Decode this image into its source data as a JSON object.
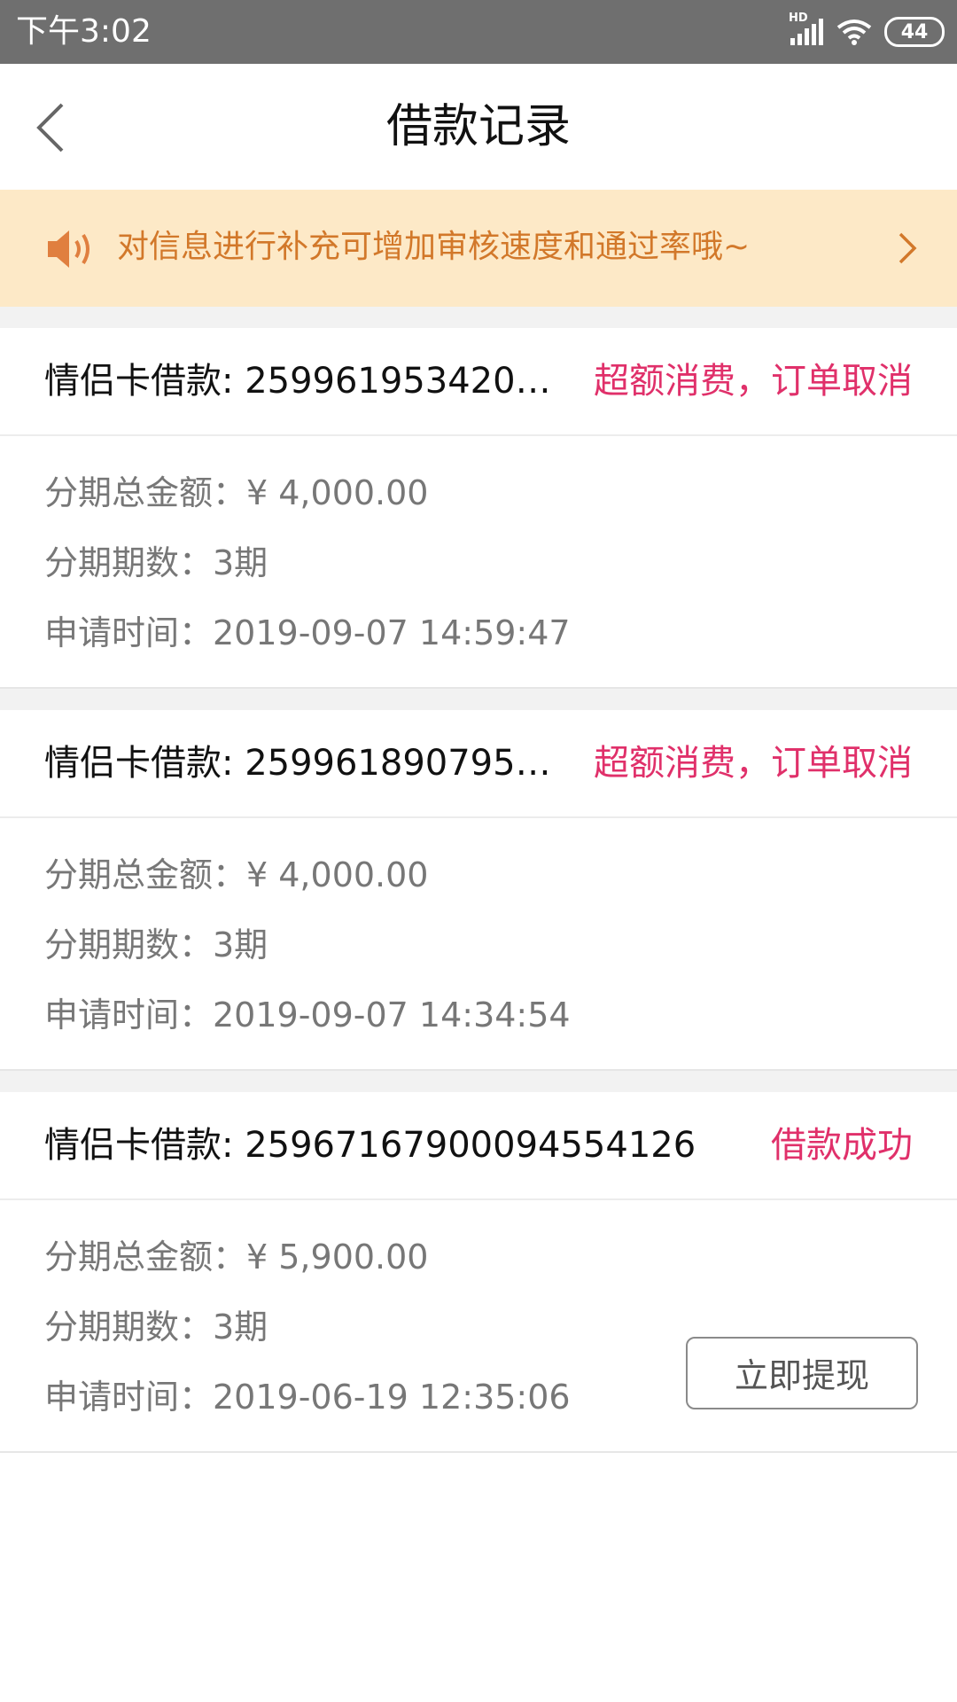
{
  "status_bar": {
    "time": "下午3:02",
    "network_badge": "HD",
    "battery_level": "44",
    "icons": [
      "signal-icon",
      "wifi-icon",
      "battery-icon"
    ]
  },
  "header": {
    "title": "借款记录",
    "back_icon": "chevron-left-icon"
  },
  "notice": {
    "text": "对信息进行补充可增加审核速度和通过率哦~",
    "icon": "speaker-icon",
    "chevron_icon": "chevron-right-icon",
    "colors": {
      "background": "#fde9c7",
      "text": "#d2782a"
    }
  },
  "colors": {
    "status_accent": "#e0306a",
    "label_gray": "#777777",
    "divider": "#ececec"
  },
  "records": [
    {
      "title": "情侣卡借款: 2599619534207...",
      "status": "超额消费，订单取消",
      "total_amount": "分期总金额：¥ 4,000.00",
      "installments": "分期期数：3期",
      "apply_time": "申请时间：2019-09-07 14:59:47"
    },
    {
      "title": "情侣卡借款: 2599618907951...",
      "status": "超额消费，订单取消",
      "total_amount": "分期总金额：¥ 4,000.00",
      "installments": "分期期数：3期",
      "apply_time": "申请时间：2019-09-07 14:34:54"
    },
    {
      "title": "情侣卡借款: 25967167900094554126",
      "status": "借款成功",
      "total_amount": "分期总金额：¥ 5,900.00",
      "installments": "分期期数：3期",
      "apply_time": "申请时间：2019-06-19 12:35:06",
      "action_label": "立即提现"
    }
  ]
}
